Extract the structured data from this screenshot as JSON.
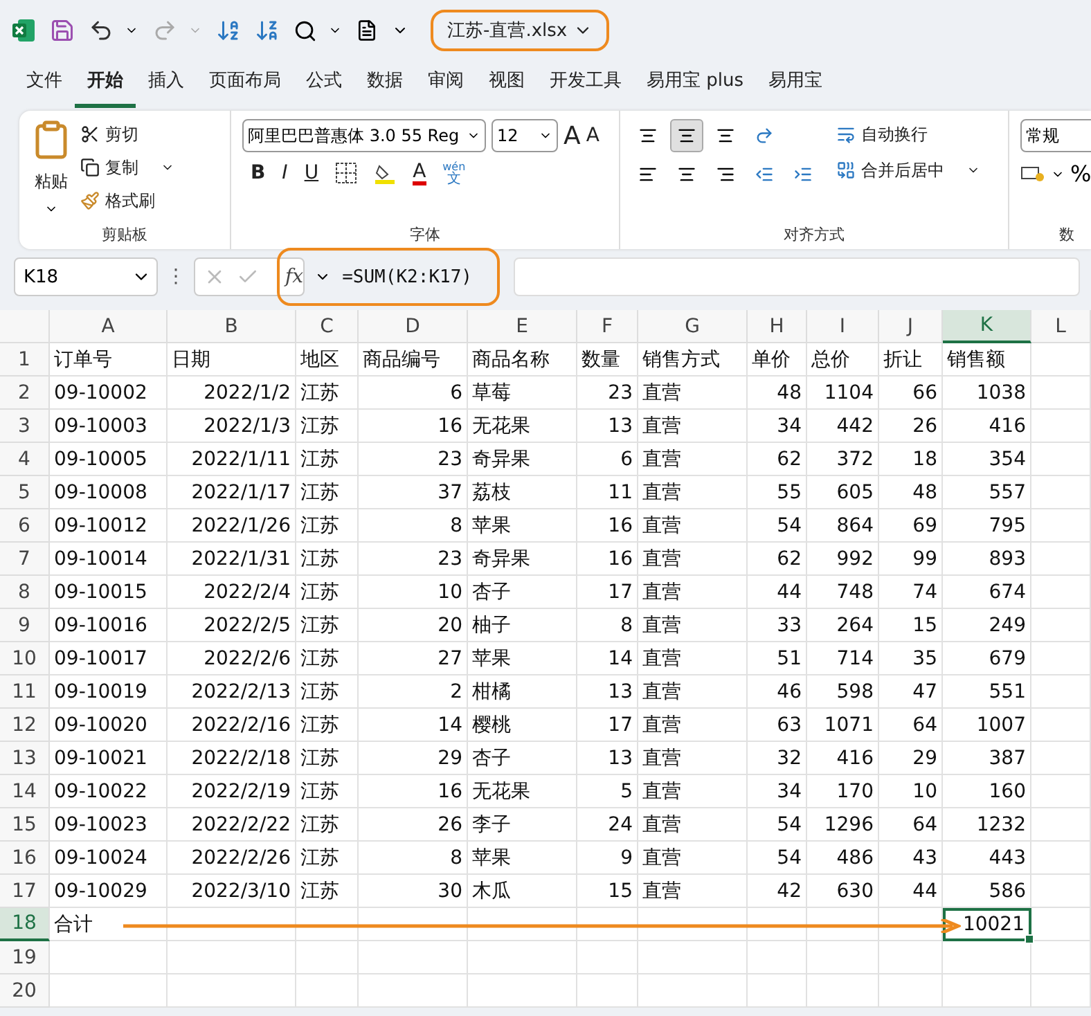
{
  "title_bar": {
    "file_name": "江苏-直营.xlsx"
  },
  "menu_tabs": [
    {
      "label": "文件",
      "selected": false
    },
    {
      "label": "开始",
      "selected": true
    },
    {
      "label": "插入",
      "selected": false
    },
    {
      "label": "页面布局",
      "selected": false
    },
    {
      "label": "公式",
      "selected": false
    },
    {
      "label": "数据",
      "selected": false
    },
    {
      "label": "审阅",
      "selected": false
    },
    {
      "label": "视图",
      "selected": false
    },
    {
      "label": "开发工具",
      "selected": false
    },
    {
      "label": "易用宝 plus",
      "selected": false
    },
    {
      "label": "易用宝",
      "selected": false
    }
  ],
  "ribbon": {
    "clipboard": {
      "paste": "粘贴",
      "cut": "剪切",
      "copy": "复制",
      "format_painter": "格式刷",
      "label": "剪贴板"
    },
    "font": {
      "font_name": "阿里巴巴普惠体 3.0 55 Reg",
      "font_size": "12",
      "grow": "A",
      "shrink": "A",
      "bold": "B",
      "italic": "I",
      "underline": "U",
      "font_color": "A",
      "phonetic_top": "wén",
      "phonetic_bottom": "文",
      "label": "字体"
    },
    "alignment": {
      "wrap": "自动换行",
      "merge": "合并后居中",
      "label": "对齐方式",
      "middle_align_selected": true
    },
    "number": {
      "format": "常规",
      "percent": "%",
      "label": "数"
    }
  },
  "formula_bar": {
    "name_box": "K18",
    "more": "⋮",
    "fx": "fx",
    "formula": "=SUM(K2:K17)"
  },
  "sheet": {
    "columns": [
      {
        "label": "A",
        "selected": false
      },
      {
        "label": "B",
        "selected": false
      },
      {
        "label": "C",
        "selected": false
      },
      {
        "label": "D",
        "selected": false
      },
      {
        "label": "E",
        "selected": false
      },
      {
        "label": "F",
        "selected": false
      },
      {
        "label": "G",
        "selected": false
      },
      {
        "label": "H",
        "selected": false
      },
      {
        "label": "I",
        "selected": false
      },
      {
        "label": "J",
        "selected": false
      },
      {
        "label": "K",
        "selected": true
      },
      {
        "label": "L",
        "selected": false
      }
    ],
    "rows": [
      {
        "kind": "data",
        "number": "1",
        "selected": false,
        "cells": [
          "订单号",
          "日期",
          "地区",
          "商品编号",
          "商品名称",
          "数量",
          "销售方式",
          "单价",
          "总价",
          "折让",
          "销售额"
        ]
      },
      {
        "kind": "data",
        "number": "2",
        "selected": false,
        "cells": [
          "09-10002",
          "2022/1/2",
          "江苏",
          "6",
          "草莓",
          "23",
          "直营",
          "48",
          "1104",
          "66",
          "1038"
        ]
      },
      {
        "kind": "data",
        "number": "3",
        "selected": false,
        "cells": [
          "09-10003",
          "2022/1/3",
          "江苏",
          "16",
          "无花果",
          "13",
          "直营",
          "34",
          "442",
          "26",
          "416"
        ]
      },
      {
        "kind": "data",
        "number": "4",
        "selected": false,
        "cells": [
          "09-10005",
          "2022/1/11",
          "江苏",
          "23",
          "奇异果",
          "6",
          "直营",
          "62",
          "372",
          "18",
          "354"
        ]
      },
      {
        "kind": "data",
        "number": "5",
        "selected": false,
        "cells": [
          "09-10008",
          "2022/1/17",
          "江苏",
          "37",
          "荔枝",
          "11",
          "直营",
          "55",
          "605",
          "48",
          "557"
        ]
      },
      {
        "kind": "data",
        "number": "6",
        "selected": false,
        "cells": [
          "09-10012",
          "2022/1/26",
          "江苏",
          "8",
          "苹果",
          "16",
          "直营",
          "54",
          "864",
          "69",
          "795"
        ]
      },
      {
        "kind": "data",
        "number": "7",
        "selected": false,
        "cells": [
          "09-10014",
          "2022/1/31",
          "江苏",
          "23",
          "奇异果",
          "16",
          "直营",
          "62",
          "992",
          "99",
          "893"
        ]
      },
      {
        "kind": "data",
        "number": "8",
        "selected": false,
        "cells": [
          "09-10015",
          "2022/2/4",
          "江苏",
          "10",
          "杏子",
          "17",
          "直营",
          "44",
          "748",
          "74",
          "674"
        ]
      },
      {
        "kind": "data",
        "number": "9",
        "selected": false,
        "cells": [
          "09-10016",
          "2022/2/5",
          "江苏",
          "20",
          "柚子",
          "8",
          "直营",
          "33",
          "264",
          "15",
          "249"
        ]
      },
      {
        "kind": "data",
        "number": "10",
        "selected": false,
        "cells": [
          "09-10017",
          "2022/2/6",
          "江苏",
          "27",
          "苹果",
          "14",
          "直营",
          "51",
          "714",
          "35",
          "679"
        ]
      },
      {
        "kind": "data",
        "number": "11",
        "selected": false,
        "cells": [
          "09-10019",
          "2022/2/13",
          "江苏",
          "2",
          "柑橘",
          "13",
          "直营",
          "46",
          "598",
          "47",
          "551"
        ]
      },
      {
        "kind": "data",
        "number": "12",
        "selected": false,
        "cells": [
          "09-10020",
          "2022/2/16",
          "江苏",
          "14",
          "樱桃",
          "17",
          "直营",
          "63",
          "1071",
          "64",
          "1007"
        ]
      },
      {
        "kind": "data",
        "number": "13",
        "selected": false,
        "cells": [
          "09-10021",
          "2022/2/18",
          "江苏",
          "29",
          "杏子",
          "13",
          "直营",
          "32",
          "416",
          "29",
          "387"
        ]
      },
      {
        "kind": "data",
        "number": "14",
        "selected": false,
        "cells": [
          "09-10022",
          "2022/2/19",
          "江苏",
          "16",
          "无花果",
          "5",
          "直营",
          "34",
          "170",
          "10",
          "160"
        ]
      },
      {
        "kind": "data",
        "number": "15",
        "selected": false,
        "cells": [
          "09-10023",
          "2022/2/22",
          "江苏",
          "26",
          "李子",
          "24",
          "直营",
          "54",
          "1296",
          "64",
          "1232"
        ]
      },
      {
        "kind": "data",
        "number": "16",
        "selected": false,
        "cells": [
          "09-10024",
          "2022/2/26",
          "江苏",
          "8",
          "苹果",
          "9",
          "直营",
          "54",
          "486",
          "43",
          "443"
        ]
      },
      {
        "kind": "data",
        "number": "17",
        "selected": false,
        "cells": [
          "09-10029",
          "2022/3/10",
          "江苏",
          "30",
          "木瓜",
          "15",
          "直营",
          "42",
          "630",
          "44",
          "586"
        ]
      },
      {
        "kind": "total",
        "number": "18",
        "selected": true,
        "label": "合计",
        "value": "10021"
      },
      {
        "kind": "empty",
        "number": "19",
        "selected": false
      },
      {
        "kind": "empty",
        "number": "20",
        "selected": false
      }
    ]
  }
}
